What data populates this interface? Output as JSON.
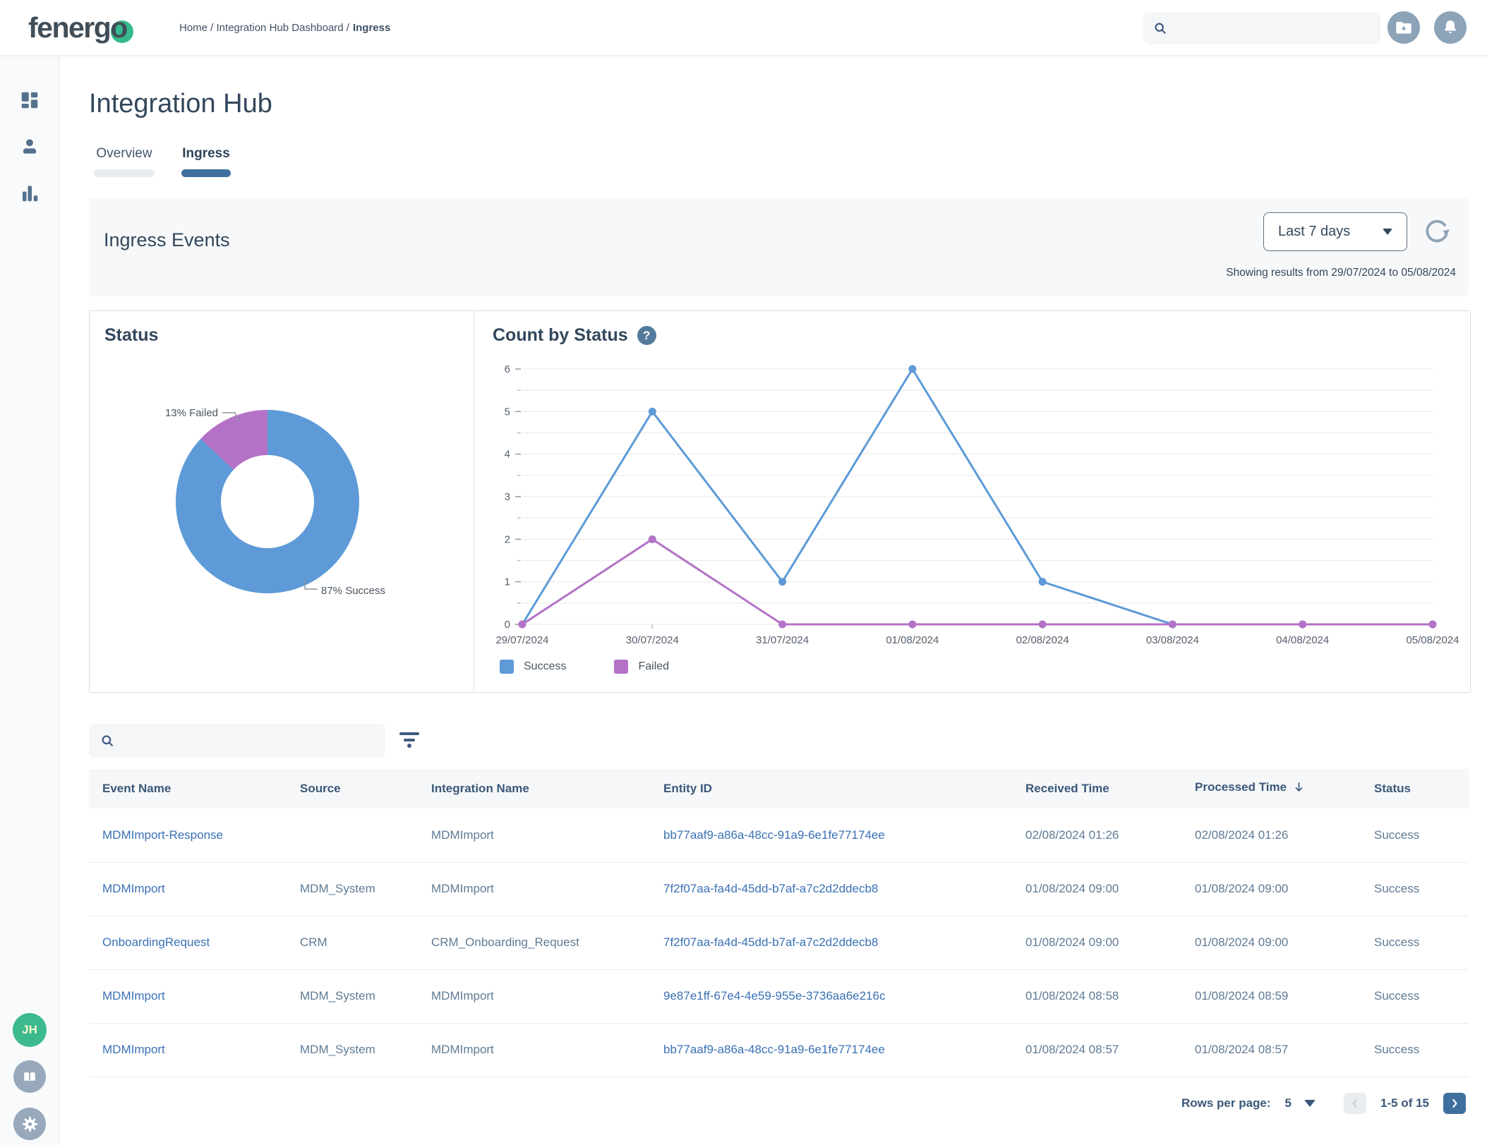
{
  "header": {
    "logo_text": "fenergo",
    "breadcrumb": {
      "path": "Home / Integration Hub Dashboard /",
      "current": "Ingress"
    },
    "search_placeholder": ""
  },
  "sidebar": {
    "items": [
      "dashboard",
      "user",
      "analytics"
    ],
    "avatar_initials": "JH",
    "bottom_items": [
      "documentation",
      "settings"
    ]
  },
  "page": {
    "title": "Integration Hub",
    "tabs": [
      {
        "label": "Overview",
        "active": false
      },
      {
        "label": "Ingress",
        "active": true
      }
    ]
  },
  "ingress_events": {
    "title": "Ingress Events",
    "range_label": "Last 7 days",
    "showing_results": "Showing results from 29/07/2024 to 05/08/2024"
  },
  "chart_data": [
    {
      "type": "pie",
      "title": "Status",
      "donut": true,
      "labels": [
        "Success",
        "Failed"
      ],
      "values": [
        87,
        13
      ],
      "unit": "%",
      "colors": {
        "Success": "#5d9ad7",
        "Failed": "#b472c7"
      },
      "failed_callout": "13% Failed",
      "success_callout": "87% Success"
    },
    {
      "type": "line",
      "title": "Count by Status",
      "categories": [
        "29/07/2024",
        "30/07/2024",
        "31/07/2024",
        "01/08/2024",
        "02/08/2024",
        "03/08/2024",
        "04/08/2024",
        "05/08/2024"
      ],
      "series": [
        {
          "name": "Success",
          "color": "#5d9ad7",
          "values": [
            0,
            5,
            1,
            6,
            1,
            0,
            0,
            0
          ]
        },
        {
          "name": "Failed",
          "color": "#b472c7",
          "values": [
            0,
            2,
            0,
            0,
            0,
            0,
            0,
            0
          ]
        }
      ],
      "ylim": [
        0,
        6
      ],
      "y_major_step": 1,
      "y_minor_step": 0.5,
      "grid": true,
      "legend_position": "bottom"
    }
  ],
  "table": {
    "search_placeholder": "",
    "columns": [
      {
        "label": "Event Name"
      },
      {
        "label": "Source"
      },
      {
        "label": "Integration Name"
      },
      {
        "label": "Entity ID"
      },
      {
        "label": "Received Time"
      },
      {
        "label": "Processed Time",
        "sorted": "desc"
      },
      {
        "label": "Status"
      }
    ],
    "rows": [
      {
        "event_name": "MDMImport-Response",
        "source": "",
        "integration_name": "MDMImport",
        "entity_id": "bb77aaf9-a86a-48cc-91a9-6e1fe77174ee",
        "received_time": "02/08/2024 01:26",
        "processed_time": "02/08/2024 01:26",
        "status": "Success"
      },
      {
        "event_name": "MDMImport",
        "source": "MDM_System",
        "integration_name": "MDMImport",
        "entity_id": "7f2f07aa-fa4d-45dd-b7af-a7c2d2ddecb8",
        "received_time": "01/08/2024 09:00",
        "processed_time": "01/08/2024 09:00",
        "status": "Success"
      },
      {
        "event_name": "OnboardingRequest",
        "source": "CRM",
        "integration_name": "CRM_Onboarding_Request",
        "entity_id": "7f2f07aa-fa4d-45dd-b7af-a7c2d2ddecb8",
        "received_time": "01/08/2024 09:00",
        "processed_time": "01/08/2024 09:00",
        "status": "Success"
      },
      {
        "event_name": "MDMImport",
        "source": "MDM_System",
        "integration_name": "MDMImport",
        "entity_id": "9e87e1ff-67e4-4e59-955e-3736aa6e216c",
        "received_time": "01/08/2024 08:58",
        "processed_time": "01/08/2024 08:59",
        "status": "Success"
      },
      {
        "event_name": "MDMImport",
        "source": "MDM_System",
        "integration_name": "MDMImport",
        "entity_id": "bb77aaf9-a86a-48cc-91a9-6e1fe77174ee",
        "received_time": "01/08/2024 08:57",
        "processed_time": "01/08/2024 08:57",
        "status": "Success"
      }
    ]
  },
  "pagination": {
    "rows_per_page_label": "Rows per page:",
    "rows_per_page": "5",
    "range": "1-5 of 15"
  }
}
